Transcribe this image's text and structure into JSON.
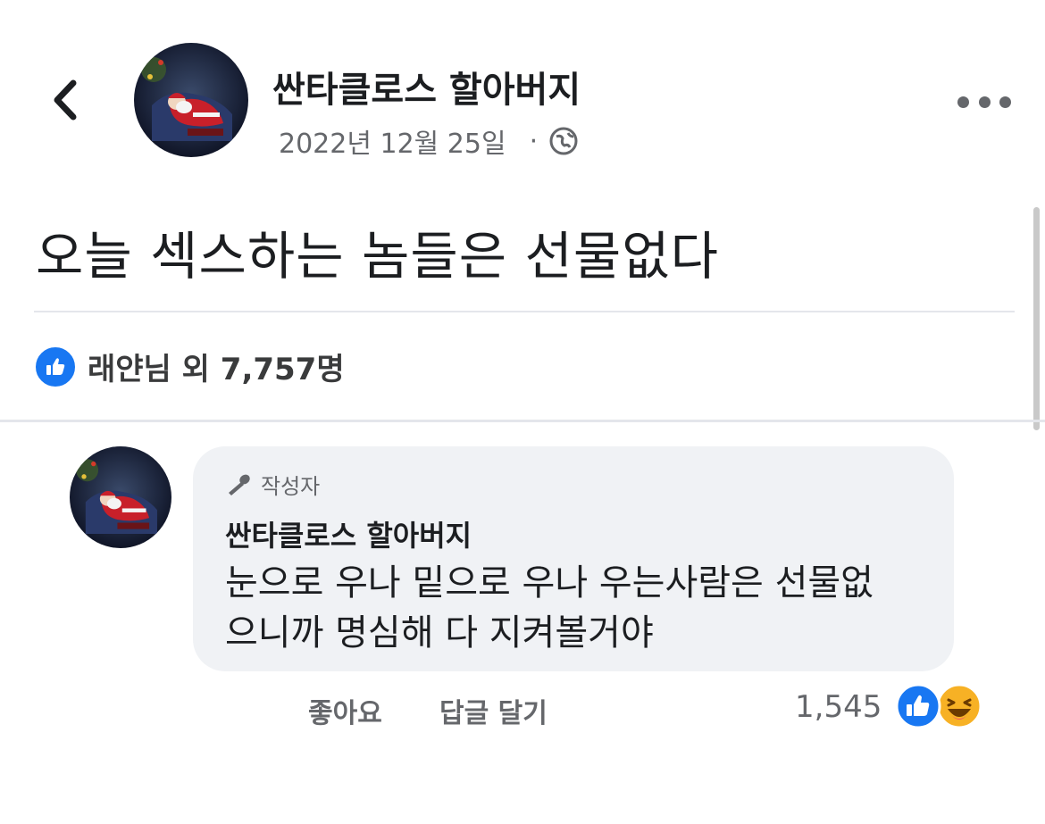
{
  "header": {
    "author_name": "싼타클로스 할아버지",
    "date": "2022년 12월 25일",
    "privacy_icon": "globe-icon",
    "back_icon": "chevron-left-icon",
    "more_icon": "more-horizontal-icon"
  },
  "post": {
    "text": "오늘 섹스하는 놈들은 선물없다",
    "reactions_summary": "래얀님 외 7,757명",
    "reaction_icon": "like-icon"
  },
  "comment": {
    "author_badge": "작성자",
    "author_name": "싼타클로스 할아버지",
    "text_line1": "눈으로 우나 밑으로 우나 우는사람은 선물없",
    "text_line2": "으니까 명심해 다 지켜볼거야",
    "like_label": "좋아요",
    "reply_label": "답글 달기",
    "reaction_count": "1,545",
    "reaction_icons": [
      "like-icon",
      "haha-icon"
    ]
  },
  "colors": {
    "facebook_blue": "#1877f2",
    "secondary_text": "#65676b",
    "bubble_bg": "#f0f2f5",
    "haha_yellow": "#f7b125"
  }
}
